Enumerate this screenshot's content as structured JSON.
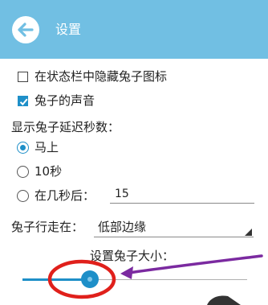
{
  "appbar": {
    "title": "设置",
    "back_icon": "arrow-left-icon",
    "color": "#71bfe3"
  },
  "settings": {
    "hide_icon_label": "在状态栏中隐藏兔子图标",
    "hide_icon_checked": false,
    "sound_label": "兔子的声音",
    "sound_checked": true,
    "delay_heading": "显示兔子延迟秒数：",
    "delay_options": [
      {
        "label": "马上",
        "selected": true
      },
      {
        "label": "10秒",
        "selected": false
      },
      {
        "label": "在几秒后：",
        "selected": false
      }
    ],
    "delay_seconds_value": "15",
    "walk_label": "兔子行走在：",
    "walk_value": "低部边缘",
    "size_label": "设置兔子大小：",
    "size_level": 0.3
  },
  "colors": {
    "accent": "#1e8fc8",
    "annotation_red": "#e0201b",
    "annotation_purple": "#7b2aa0"
  }
}
